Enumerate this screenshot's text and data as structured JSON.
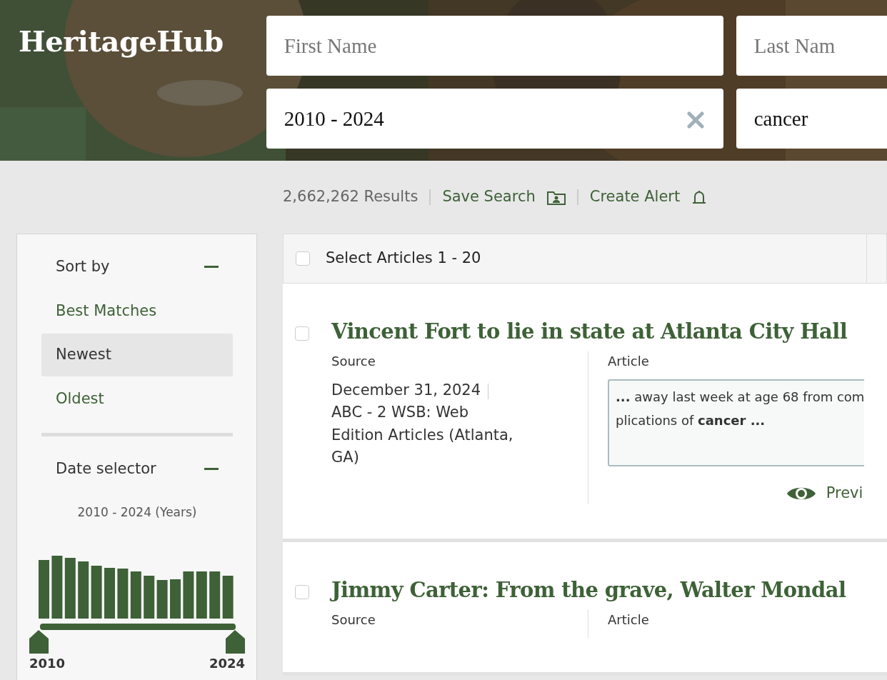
{
  "header": {
    "logo": "HeritageHub",
    "fields": [
      {
        "placeholder": "First Name"
      },
      {
        "placeholder": "Last Nam"
      },
      {
        "value": "2010 - 2024",
        "clearable": true
      },
      {
        "value": "cancer",
        "clearable": false
      }
    ]
  },
  "results": {
    "count": "2,662,262 Results",
    "actions": [
      {
        "label": "Save Search",
        "kind": "folder"
      },
      {
        "label": "Create Alert",
        "kind": "bell"
      }
    ]
  },
  "sidebar": {
    "sections": [
      {
        "kind": "options",
        "title": "Sort by",
        "expanded": true,
        "options": [
          {
            "label": "Best Matches",
            "selected": false
          },
          {
            "label": "Newest",
            "selected": true
          },
          {
            "label": "Oldest",
            "selected": false
          }
        ]
      },
      {
        "kind": "dates",
        "title": "Date selector",
        "expanded": true,
        "range_label": "2010 - 2024 (Years)",
        "range_start": "2010",
        "range_end": "2024"
      }
    ]
  },
  "select_all": {
    "label": "Select Articles 1 - 20",
    "checked": false
  },
  "articles": [
    {
      "title": "Vincent Fort to lie in state at Atlanta City Hall",
      "checked": false,
      "source_label": "Source",
      "date": "December 31, 2024",
      "publication": "ABC - 2 WSB: Web Edition Articles (Atlanta, GA)",
      "article_label": "Article",
      "snippet_lines": [
        "**...** away last week at age 68 from com",
        "plications of **cancer ...**"
      ],
      "preview": "Previ"
    },
    {
      "title": "Jimmy Carter: From the grave, Walter Mondal",
      "checked": false,
      "source_label": "Source",
      "article_label": "Article"
    }
  ]
}
